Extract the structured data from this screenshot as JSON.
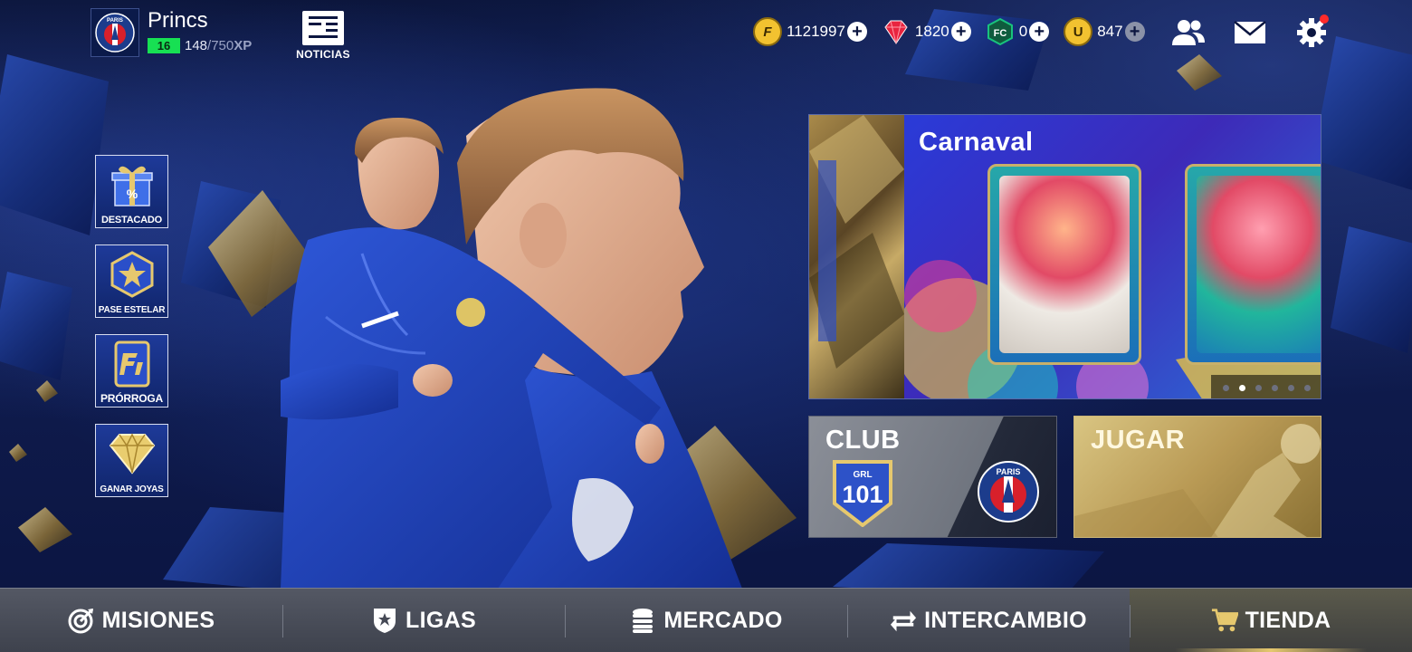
{
  "profile": {
    "name": "Princs",
    "level": "16",
    "xp_current": "148",
    "xp_max": "/750",
    "xp_unit": "XP",
    "club_crest_text": "PARIS"
  },
  "news": {
    "label": "NOTICIAS"
  },
  "currencies": [
    {
      "name": "coins",
      "value": "1121997",
      "color": "#f2c230"
    },
    {
      "name": "gems",
      "value": "1820",
      "color": "#e8243f"
    },
    {
      "name": "fc-points",
      "value": "0",
      "color": "#19c37d"
    },
    {
      "name": "tokens",
      "value": "847",
      "color": "#f2c230"
    }
  ],
  "side_menu": [
    {
      "id": "destacado",
      "label": "DESTACADO",
      "icon": "gift-icon"
    },
    {
      "id": "pase-estelar",
      "label": "PASE ESTELAR",
      "icon": "star-badge-icon"
    },
    {
      "id": "prorroga",
      "label": "PRÓRROGA",
      "icon": "fc-card-icon"
    },
    {
      "id": "ganar-joyas",
      "label": "GANAR JOYAS",
      "icon": "diamond-icon"
    }
  ],
  "banner": {
    "title": "Carnaval",
    "slide_count": 6,
    "active_slide": 2
  },
  "club_tile": {
    "title": "CLUB",
    "grl_label": "GRL",
    "grl_value": "101",
    "crest_text": "PARIS"
  },
  "play_tile": {
    "title": "JUGAR"
  },
  "bottom_nav": [
    {
      "id": "misiones",
      "label": "MISIONES",
      "icon": "target-icon",
      "active": false
    },
    {
      "id": "ligas",
      "label": "LIGAS",
      "icon": "shield-star-icon",
      "active": false
    },
    {
      "id": "mercado",
      "label": "MERCADO",
      "icon": "coin-stack-icon",
      "active": false
    },
    {
      "id": "intercambio",
      "label": "INTERCAMBIO",
      "icon": "swap-arrows-icon",
      "active": false
    },
    {
      "id": "tienda",
      "label": "TIENDA",
      "icon": "cart-icon",
      "active": true
    }
  ],
  "colors": {
    "accent_gold": "#e6c86e",
    "level_green": "#17e053",
    "notification_red": "#ff2a2a"
  }
}
